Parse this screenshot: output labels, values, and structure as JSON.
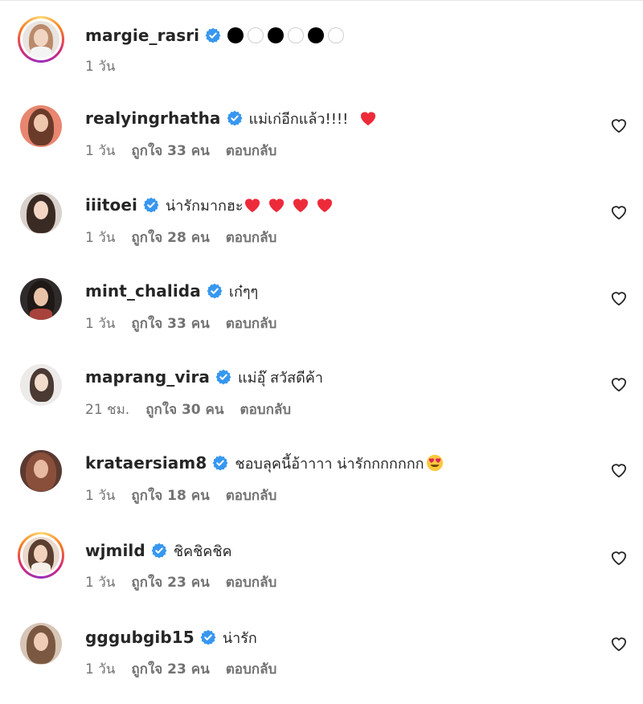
{
  "colors": {
    "verified": "#3797f0",
    "secondary_text": "#737373",
    "primary_text": "#262626",
    "heart_red": "#ed4956"
  },
  "caption": {
    "username": "margie_rasri",
    "dots": [
      "filled",
      "empty",
      "filled",
      "empty",
      "filled",
      "empty"
    ],
    "time": "1 วัน"
  },
  "comments": [
    {
      "username": "realyingrhatha",
      "text": "แม่เก่อีกแล้ว!!!!",
      "emoji": "red-heart",
      "time": "1 วัน",
      "likes": "ถูกใจ 33 คน",
      "reply": "ตอบกลับ"
    },
    {
      "username": "iiitoei",
      "text": "น่ารักมากฮะ",
      "emoji": "red-heart-x4",
      "time": "1 วัน",
      "likes": "ถูกใจ 28 คน",
      "reply": "ตอบกลับ"
    },
    {
      "username": "mint_chalida",
      "text": "เก๋ๆๆ",
      "time": "1 วัน",
      "likes": "ถูกใจ 33 คน",
      "reply": "ตอบกลับ"
    },
    {
      "username": "maprang_vira",
      "text": "แม่อุ๊ สวัสดีค้า",
      "time": "21 ชม.",
      "likes": "ถูกใจ 30 คน",
      "reply": "ตอบกลับ"
    },
    {
      "username": "krataersiam8",
      "text": "ชอบลุคนี้อ้าาาา น่ารักกกกกกก",
      "emoji": "heart-eyes-smile",
      "time": "1 วัน",
      "likes": "ถูกใจ 18 คน",
      "reply": "ตอบกลับ"
    },
    {
      "username": "wjmild",
      "text": "ชิคชิคชิค",
      "time": "1 วัน",
      "likes": "ถูกใจ 23 คน",
      "reply": "ตอบกลับ"
    },
    {
      "username": "gggubgib15",
      "text": "น่ารัก",
      "time": "1 วัน",
      "likes": "ถูกใจ 23 คน",
      "reply": "ตอบกลับ"
    }
  ],
  "icons": {
    "verified": "verified-badge-icon",
    "like": "heart-outline-icon"
  }
}
